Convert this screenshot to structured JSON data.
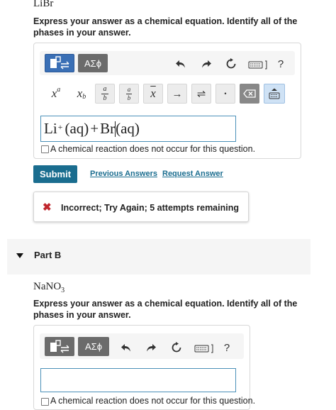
{
  "part_a": {
    "compound": "LiBr",
    "instruction": "Express your answer as a chemical equation. Identify all of the phases in your answer.",
    "toolbar": {
      "greek_label": "ΑΣϕ",
      "help_label": "?",
      "templates": {
        "superscript": {
          "base": "x",
          "exp": "a"
        },
        "subscript": {
          "base": "x",
          "sub": "b"
        },
        "fraction": {
          "num": "a",
          "den": "b"
        },
        "arrow": "→",
        "equilibrium": "⇌",
        "dot": "•"
      }
    },
    "answer": {
      "li": "Li",
      "charge": "+",
      "aq1": "(aq)",
      "plus": "+",
      "br": "Br",
      "aq2": "(aq)"
    },
    "no_reaction_label": "A chemical reaction does not occur for this question.",
    "submit_label": "Submit",
    "previous_answers_label": "Previous Answers",
    "request_answer_label": "Request Answer",
    "feedback": {
      "icon": "✖",
      "text": "Incorrect; Try Again; 5 attempts remaining",
      "color": "#c0262d"
    }
  },
  "part_b": {
    "header_label": "Part B",
    "compound_base": "NaNO",
    "compound_sub": "3",
    "instruction": "Express your answer as a chemical equation. Identify all of the phases in your answer.",
    "toolbar": {
      "greek_label": "ΑΣϕ",
      "help_label": "?"
    },
    "answer_value": "",
    "no_reaction_label": "A chemical reaction does not occur for this question."
  },
  "colors": {
    "accent": "#1a6d8f",
    "toolbar_active": "#3a6fb5",
    "error": "#c0262d"
  }
}
